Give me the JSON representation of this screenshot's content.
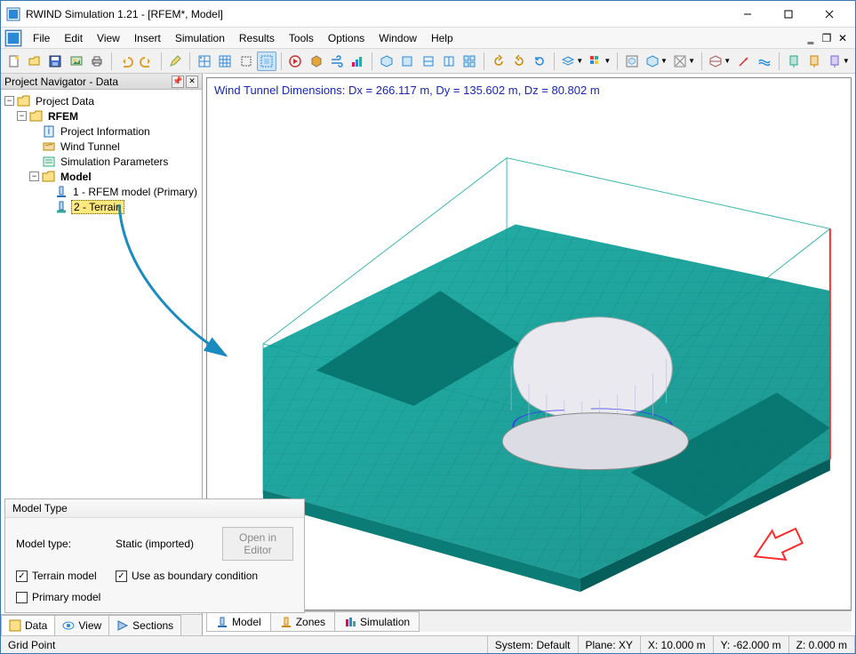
{
  "window": {
    "title": "RWIND Simulation 1.21 - [RFEM*, Model]"
  },
  "menu": {
    "items": [
      "File",
      "Edit",
      "View",
      "Insert",
      "Simulation",
      "Results",
      "Tools",
      "Options",
      "Window",
      "Help"
    ]
  },
  "navigator": {
    "title": "Project Navigator - Data",
    "root": "Project Data",
    "rfem": "RFEM",
    "project_info": "Project Information",
    "wind_tunnel": "Wind Tunnel",
    "sim_params": "Simulation Parameters",
    "model": "Model",
    "rfem_model": "1 - RFEM model (Primary)",
    "terrain": "2 - Terrain",
    "tabs": {
      "data": "Data",
      "view": "View",
      "sections": "Sections"
    }
  },
  "model_type": {
    "title": "Model Type",
    "label": "Model type:",
    "value": "Static (imported)",
    "open_btn": "Open in Editor",
    "terrain_chk": "Terrain model",
    "boundary_chk": "Use as boundary condition",
    "primary_chk": "Primary model"
  },
  "viewport": {
    "info": "Wind Tunnel Dimensions: Dx = 266.117 m, Dy = 135.602 m, Dz = 80.802 m",
    "tabs": {
      "model": "Model",
      "zones": "Zones",
      "simulation": "Simulation"
    }
  },
  "status": {
    "left": "Grid Point",
    "system": "System: Default",
    "plane": "Plane: XY",
    "x": "X:  10.000 m",
    "y": "Y:  -62.000 m",
    "z": "Z:  0.000 m"
  }
}
